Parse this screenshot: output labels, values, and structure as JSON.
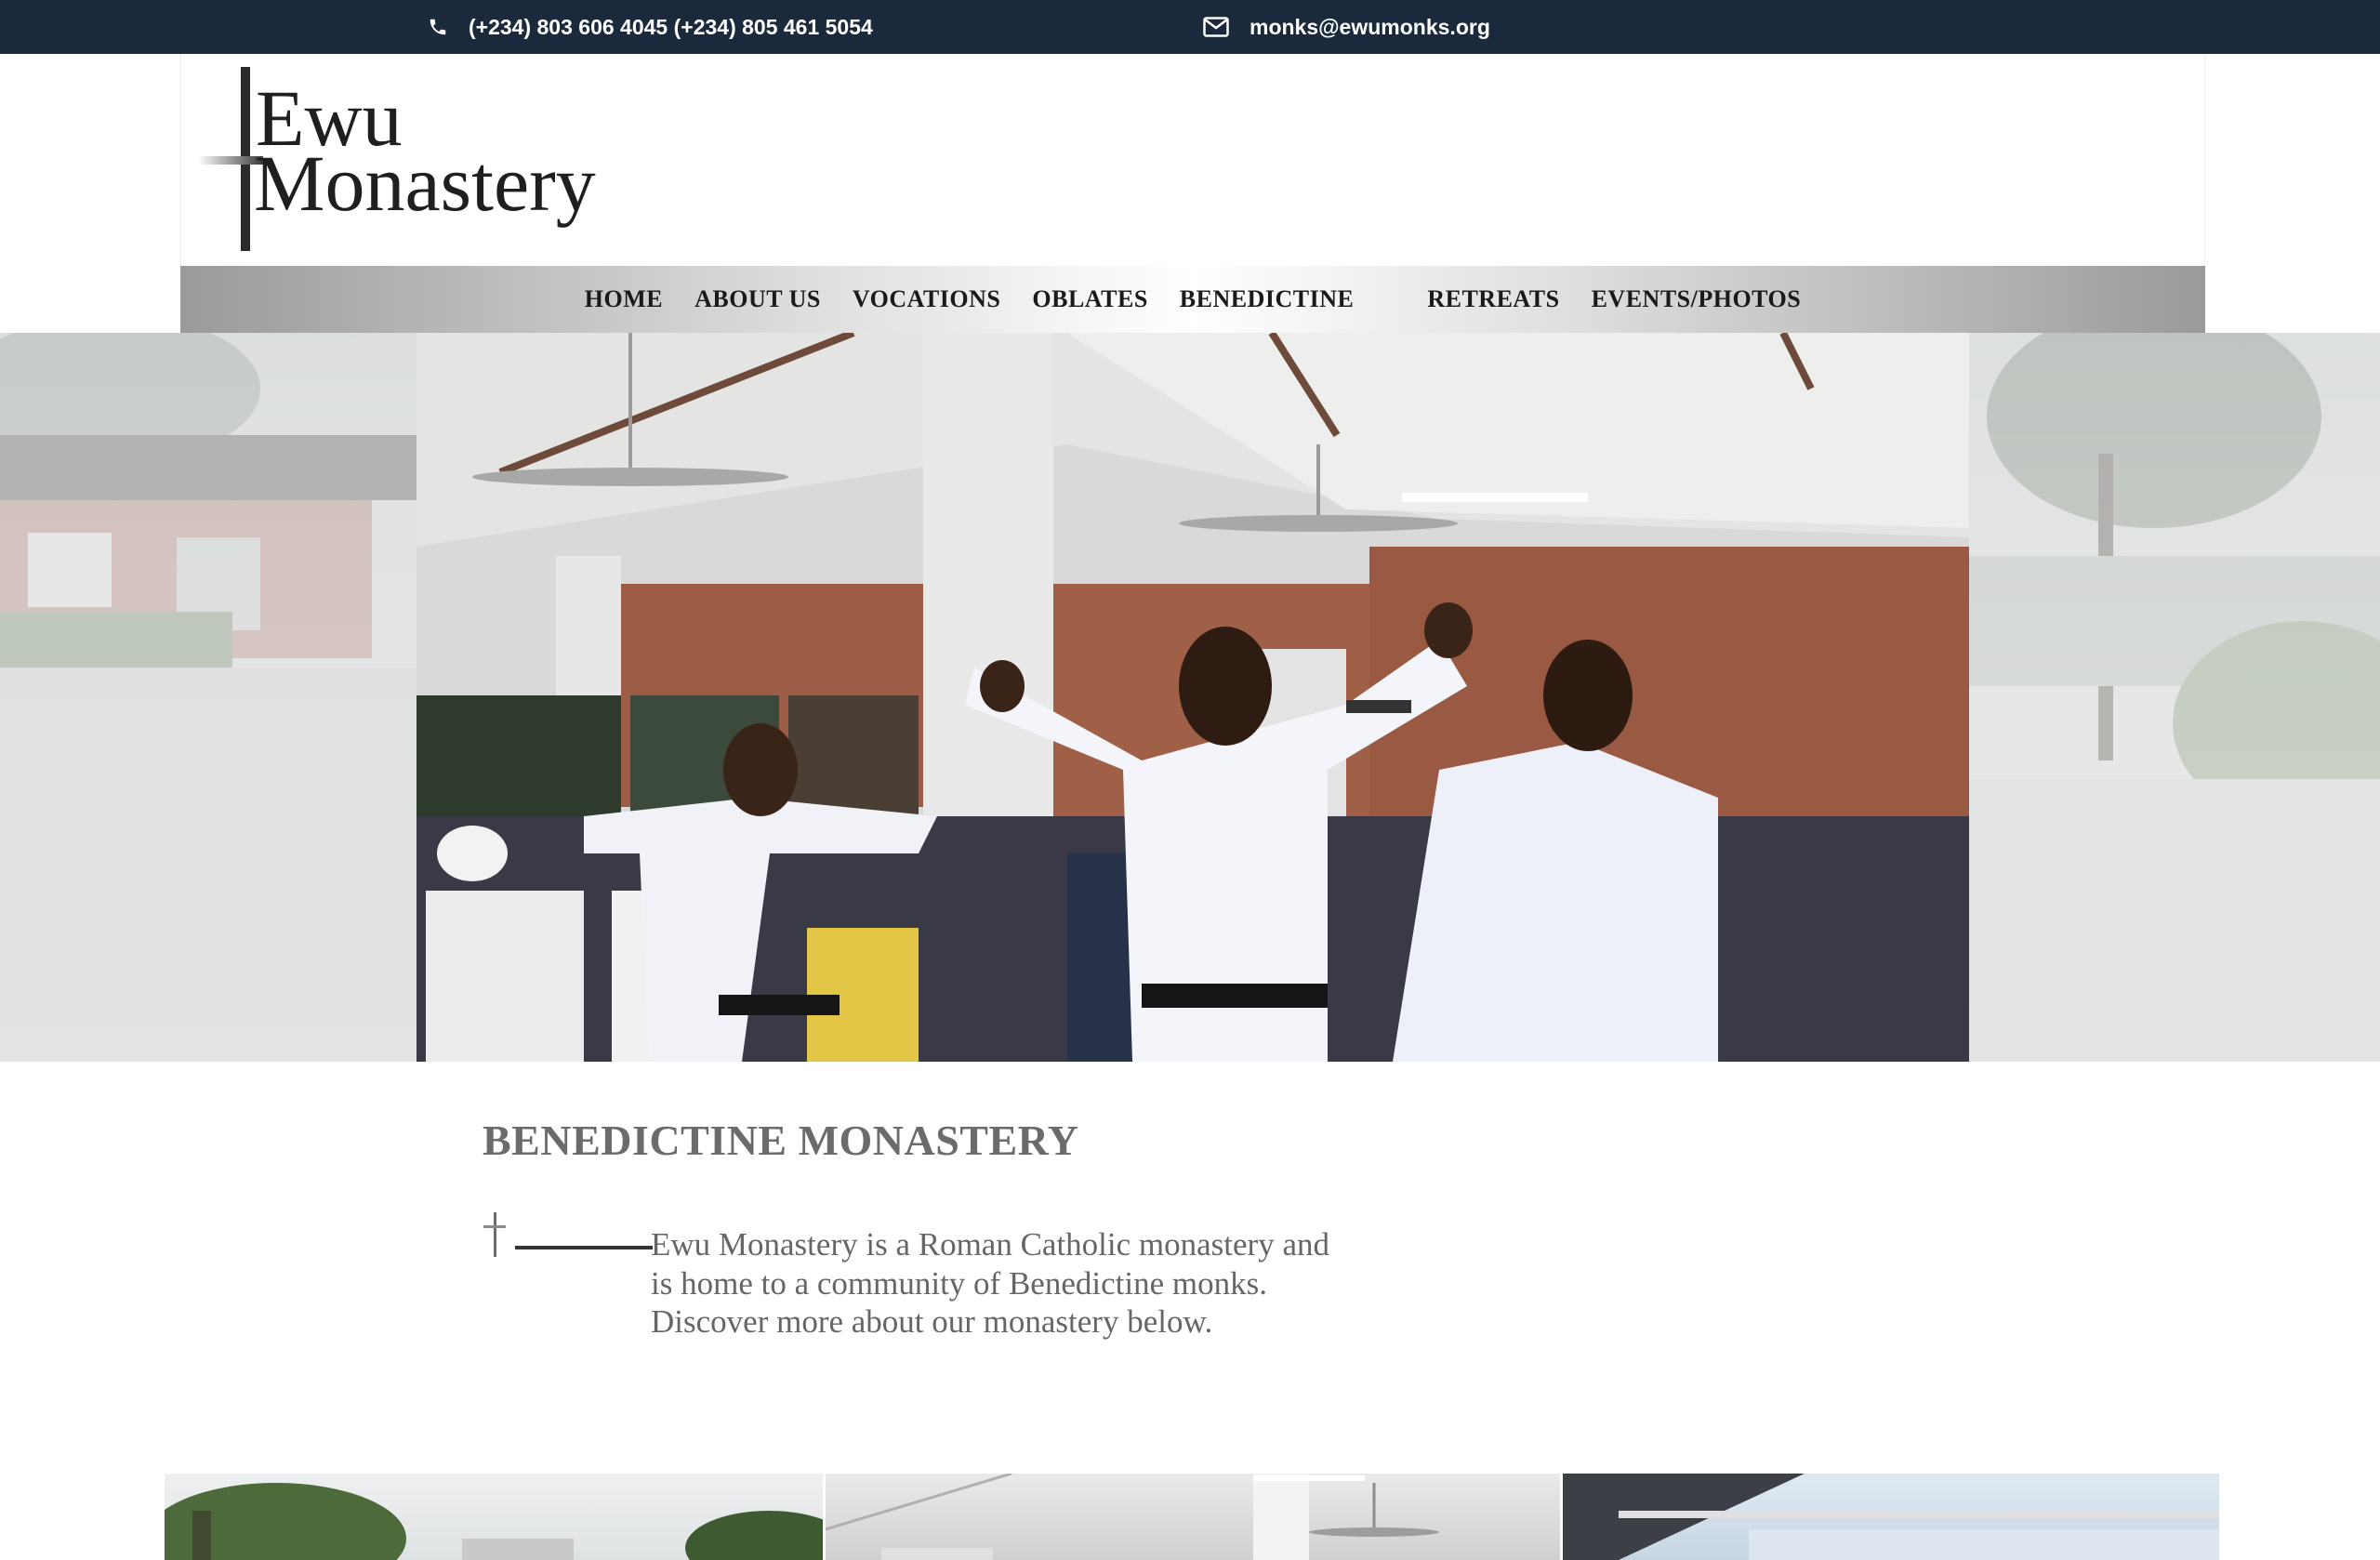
{
  "topbar": {
    "phone": "(+234) 803 606 4045 (+234) 805 461 5054",
    "email": "monks@ewumonks.org",
    "icons": [
      "phone-icon",
      "mail-icon"
    ]
  },
  "logo": {
    "line1": "Ewu",
    "line2": "Monastery"
  },
  "nav": {
    "items": [
      "HOME",
      "ABOUT US",
      "VOCATIONS",
      "OBLATES",
      "BENEDICTINE",
      "RETREATS",
      "EVENTS/PHOTOS"
    ]
  },
  "intro": {
    "title": "BENEDICTINE MONASTERY",
    "text": "Ewu Monastery is a Roman Catholic monastery and is home to a community of Benedictine monks. Discover more about our monastery below."
  },
  "colors": {
    "topbar": "#1a2a3c",
    "heading": "#6b6b6b",
    "body_text": "#666666"
  }
}
